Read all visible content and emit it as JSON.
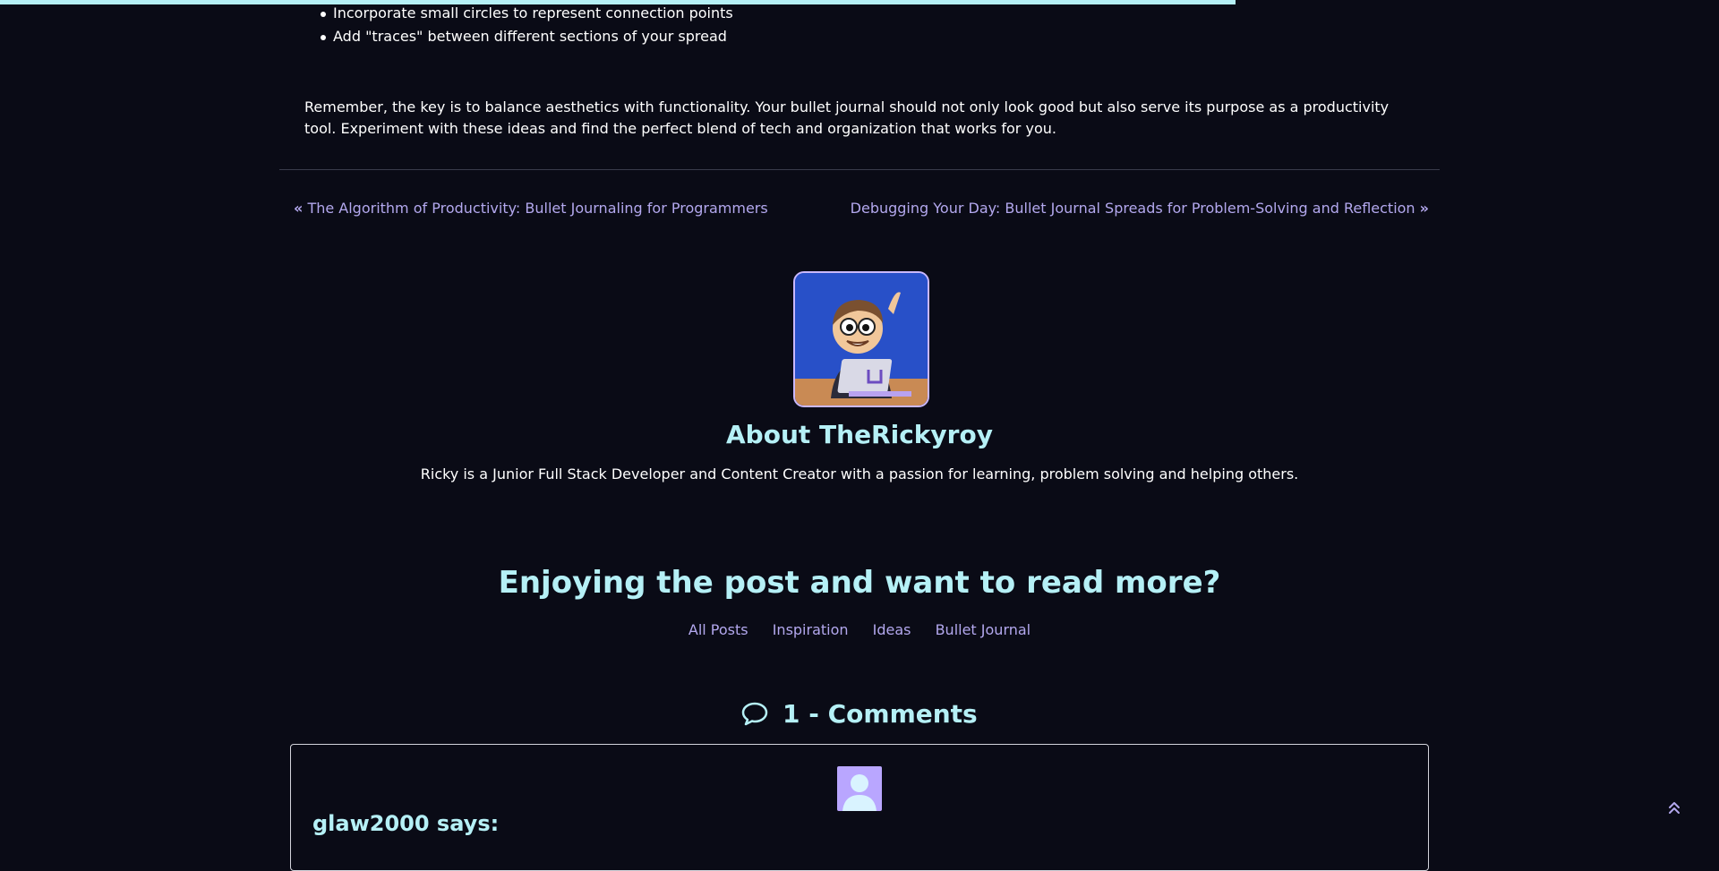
{
  "reading_progress": 0.719,
  "article": {
    "bullets": [
      "Incorporate small circles to represent connection points",
      "Add \"traces\" between different sections of your spread"
    ],
    "closing_paragraph": "Remember, the key is to balance aesthetics with functionality. Your bullet journal should not only look good but also serve its purpose as a productivity tool. Experiment with these ideas and find the perfect blend of tech and organization that works for you."
  },
  "post_nav": {
    "prev_label": "The Algorithm of Productivity: Bullet Journaling for Programmers",
    "next_label": "Debugging Your Day: Bullet Journal Spreads for Problem-Solving and Reflection"
  },
  "author": {
    "title": "About TheRickyroy",
    "bio": "Ricky is a Junior Full Stack Developer and Content Creator with a passion for learning, problem solving and helping others."
  },
  "more": {
    "title": "Enjoying the post and want to read more?",
    "links": [
      "All Posts",
      "Inspiration",
      "Ideas",
      "Bullet Journal"
    ]
  },
  "comments": {
    "title": "1 - Comments",
    "items": [
      {
        "author": "glaw2000 says:"
      }
    ]
  },
  "colors": {
    "background": "#0a0b16",
    "heading": "#b5f0f6",
    "link": "#b3a8ee",
    "avatar_bg": "#b9a6ff"
  },
  "icons": {
    "prev": "double-chevron-left-icon",
    "next": "double-chevron-right-icon",
    "comments": "speech-bubble-icon",
    "back_to_top": "double-chevron-up-icon"
  }
}
